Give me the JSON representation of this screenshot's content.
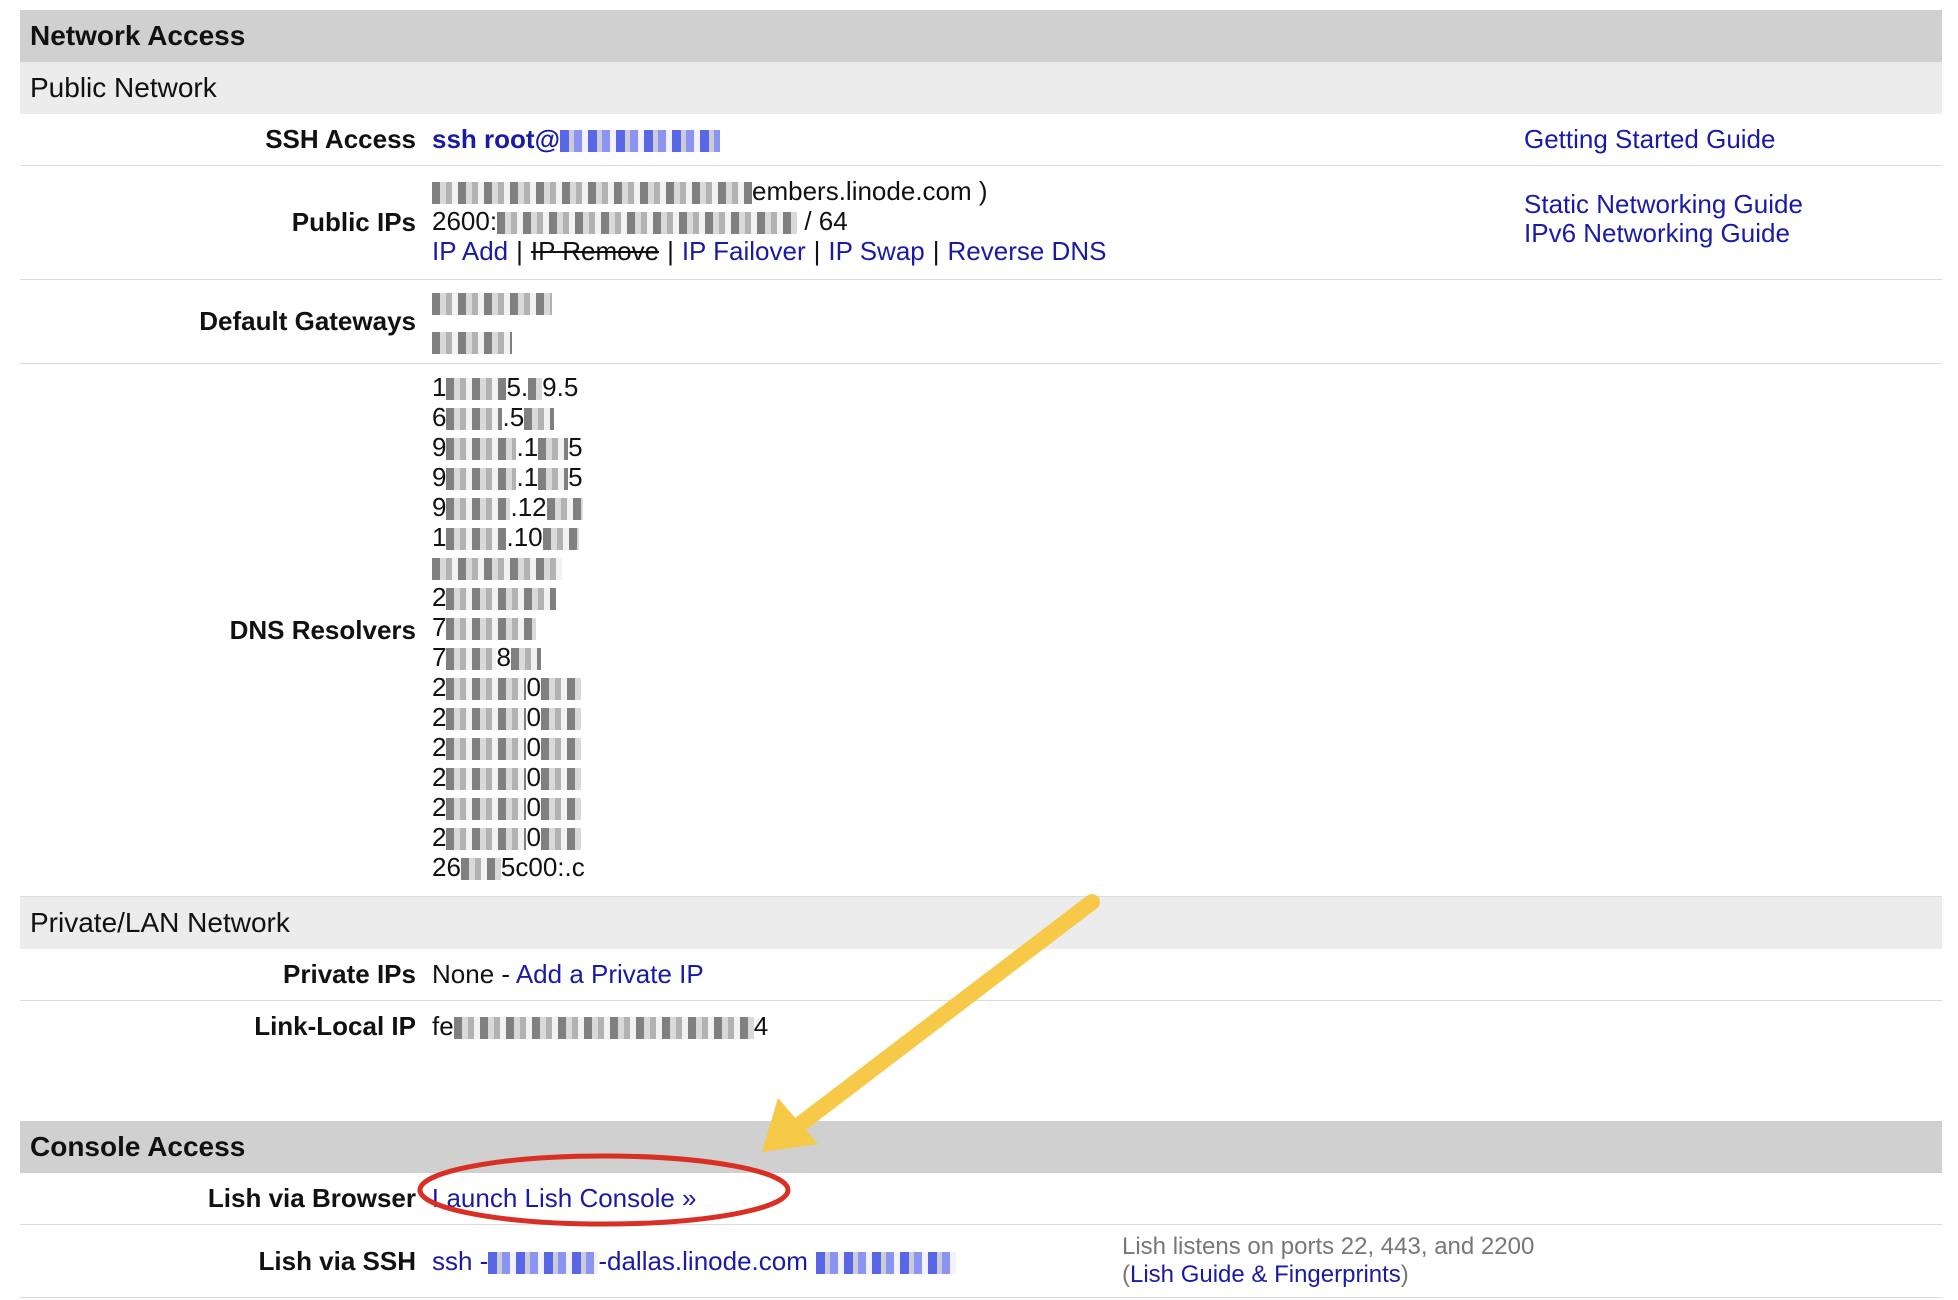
{
  "network_access": {
    "title": "Network Access",
    "public_network": {
      "title": "Public Network",
      "ssh_access": {
        "label": "SSH Access",
        "value": "ssh root@"
      },
      "public_ips": {
        "label": "Public IPs",
        "line1_suffix": "embers.linode.com )",
        "line2_prefix": "2600:",
        "line2_suffix": "/ 64",
        "actions": [
          {
            "text": "IP Add",
            "style": "link"
          },
          {
            "text": "IP Remove",
            "style": "strike"
          },
          {
            "text": "IP Failover",
            "style": "link"
          },
          {
            "text": "IP Swap",
            "style": "link"
          },
          {
            "text": "Reverse DNS",
            "style": "link"
          }
        ],
        "separator": "|"
      },
      "default_gateways": {
        "label": "Default Gateways"
      },
      "dns_resolvers": {
        "label": "DNS Resolvers",
        "visible_fragments": [
          "1",
          "5.",
          "9.5",
          "6",
          ".5",
          "9",
          ".1",
          "5",
          "9",
          ".1",
          "5",
          "9",
          ".12",
          "1",
          ".10",
          "2",
          "7",
          "7",
          "8",
          "2",
          "0",
          "2",
          "0",
          "2",
          "0",
          "2",
          "0",
          "2",
          "0",
          "2",
          "0",
          "26",
          "5c00:.c"
        ]
      },
      "guides": {
        "getting_started": "Getting Started Guide",
        "static_networking": "Static Networking Guide",
        "ipv6_networking": "IPv6 Networking Guide"
      }
    },
    "private_network": {
      "title": "Private/LAN Network",
      "private_ips": {
        "label": "Private IPs",
        "value": "None -",
        "link": "Add a Private IP"
      },
      "link_local": {
        "label": "Link-Local IP",
        "prefix": "fe",
        "suffix": "4"
      }
    }
  },
  "console_access": {
    "title": "Console Access",
    "lish_browser": {
      "label": "Lish via Browser",
      "link": "Launch Lish Console »"
    },
    "lish_ssh": {
      "label": "Lish via SSH",
      "prefix": "ssh -",
      "host": "-dallas.linode.com",
      "note": "Lish listens on ports 22, 443, and 2200",
      "guide_open": "(",
      "guide_link": "Lish Guide & Fingerprints",
      "guide_close": ")"
    }
  },
  "annotations": {
    "highlight_color": "#d93025",
    "arrow_color": "#f7c948"
  }
}
